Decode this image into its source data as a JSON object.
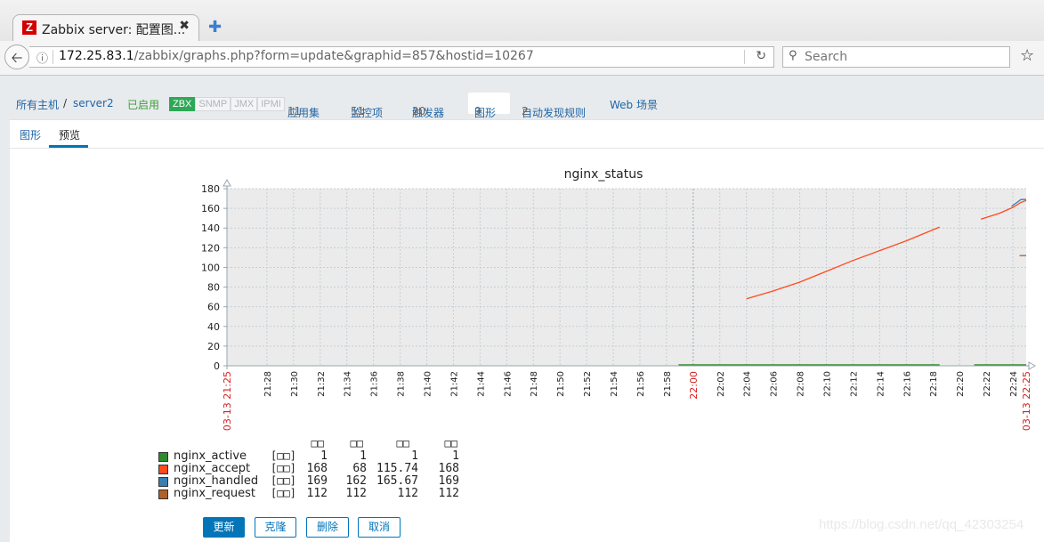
{
  "browser": {
    "tab_title": "Zabbix server: 配置图...",
    "tab_icon": "Z",
    "url_host": "172.25.83.1",
    "url_path": "/zabbix/graphs.php?form=update&graphid=857&hostid=10267",
    "search_placeholder": "Search"
  },
  "host_nav": {
    "all_hosts": "所有主机",
    "separator": "/",
    "host": "server2",
    "status": "已启用",
    "availability": [
      "ZBX",
      "SNMP",
      "JMX",
      "IPMI"
    ],
    "applications": {
      "label": "应用集",
      "count": "11"
    },
    "items": {
      "label": "监控项",
      "count": "51"
    },
    "triggers": {
      "label": "触发器",
      "count": "20"
    },
    "graphs": {
      "label": "图形",
      "count": "9"
    },
    "discovery": {
      "label": "自动发现规则",
      "count": "2"
    },
    "web": {
      "label": "Web 场景"
    }
  },
  "subtabs": {
    "graph": "图形",
    "preview": "预览"
  },
  "colors": {
    "accent": "#0275b8",
    "active": "#2e8b2e",
    "accept": "#ff4a1c",
    "handled": "#3a7fb0",
    "request": "#b0602a",
    "time_marker": "#d62020"
  },
  "chart_data": {
    "type": "line",
    "title": "nginx_status",
    "xlabel": "",
    "ylabel": "",
    "ylim": [
      0,
      180
    ],
    "yticks": [
      "0",
      "20",
      "40",
      "60",
      "80",
      "100",
      "120",
      "140",
      "160",
      "180"
    ],
    "x_range_minutes": [
      0,
      60
    ],
    "x_start_label": "03-13 21:25",
    "x_end_label": "03-13 22:25",
    "xticks": [
      {
        "t": 3,
        "label": "21:28"
      },
      {
        "t": 5,
        "label": "21:30"
      },
      {
        "t": 7,
        "label": "21:32"
      },
      {
        "t": 9,
        "label": "21:34"
      },
      {
        "t": 11,
        "label": "21:36"
      },
      {
        "t": 13,
        "label": "21:38"
      },
      {
        "t": 15,
        "label": "21:40"
      },
      {
        "t": 17,
        "label": "21:42"
      },
      {
        "t": 19,
        "label": "21:44"
      },
      {
        "t": 21,
        "label": "21:46"
      },
      {
        "t": 23,
        "label": "21:48"
      },
      {
        "t": 25,
        "label": "21:50"
      },
      {
        "t": 27,
        "label": "21:52"
      },
      {
        "t": 29,
        "label": "21:54"
      },
      {
        "t": 31,
        "label": "21:56"
      },
      {
        "t": 33,
        "label": "21:58"
      },
      {
        "t": 35,
        "label": "22:00",
        "highlight": true
      },
      {
        "t": 37,
        "label": "22:02"
      },
      {
        "t": 39,
        "label": "22:04"
      },
      {
        "t": 41,
        "label": "22:06"
      },
      {
        "t": 43,
        "label": "22:08"
      },
      {
        "t": 45,
        "label": "22:10"
      },
      {
        "t": 47,
        "label": "22:12"
      },
      {
        "t": 49,
        "label": "22:14"
      },
      {
        "t": 51,
        "label": "22:16"
      },
      {
        "t": 53,
        "label": "22:18"
      },
      {
        "t": 55,
        "label": "22:20"
      },
      {
        "t": 57,
        "label": "22:22"
      },
      {
        "t": 59,
        "label": "22:24"
      }
    ],
    "grid": true,
    "series": [
      {
        "name": "nginx_active",
        "color": "#2e8b2e",
        "segments": [
          [
            [
              33.9,
              1
            ],
            [
              53.5,
              1
            ]
          ],
          [
            [
              56.1,
              1
            ],
            [
              60,
              1
            ]
          ]
        ]
      },
      {
        "name": "nginx_accept",
        "color": "#ff4a1c",
        "segments": [
          [
            [
              39.0,
              68
            ],
            [
              41,
              76
            ],
            [
              43,
              85
            ],
            [
              45,
              96
            ],
            [
              47,
              107
            ],
            [
              49,
              117
            ],
            [
              51,
              127
            ],
            [
              53.5,
              141
            ]
          ],
          [
            [
              56.6,
              149
            ],
            [
              58,
              155
            ],
            [
              59,
              161
            ],
            [
              59.6,
              166
            ],
            [
              60,
              168
            ]
          ]
        ]
      },
      {
        "name": "nginx_handled",
        "color": "#3a7fb0",
        "segments": [
          [
            [
              58.9,
              162
            ],
            [
              59.6,
              169
            ],
            [
              60,
              169
            ]
          ]
        ]
      },
      {
        "name": "nginx_request",
        "color": "#b0602a",
        "segments": [
          [
            [
              59.5,
              112
            ],
            [
              60,
              112
            ]
          ]
        ]
      }
    ],
    "legend": {
      "position": "bottom-left",
      "headers": [
        "□□",
        "□□",
        "□□",
        "□□"
      ],
      "rows": [
        {
          "name": "nginx_active",
          "func": "[□□]",
          "last": "1",
          "min": "1",
          "avg": "1",
          "max": "1",
          "color": "#2e8b2e"
        },
        {
          "name": "nginx_accept",
          "func": "[□□]",
          "last": "168",
          "min": "68",
          "avg": "115.74",
          "max": "168",
          "color": "#ff4a1c"
        },
        {
          "name": "nginx_handled",
          "func": "[□□]",
          "last": "169",
          "min": "162",
          "avg": "165.67",
          "max": "169",
          "color": "#3a7fb0"
        },
        {
          "name": "nginx_request",
          "func": "[□□]",
          "last": "112",
          "min": "112",
          "avg": "112",
          "max": "112",
          "color": "#b0602a"
        }
      ]
    }
  },
  "buttons": {
    "update": "更新",
    "clone": "克隆",
    "delete": "删除",
    "cancel": "取消"
  },
  "watermark": "https://blog.csdn.net/qq_42303254"
}
